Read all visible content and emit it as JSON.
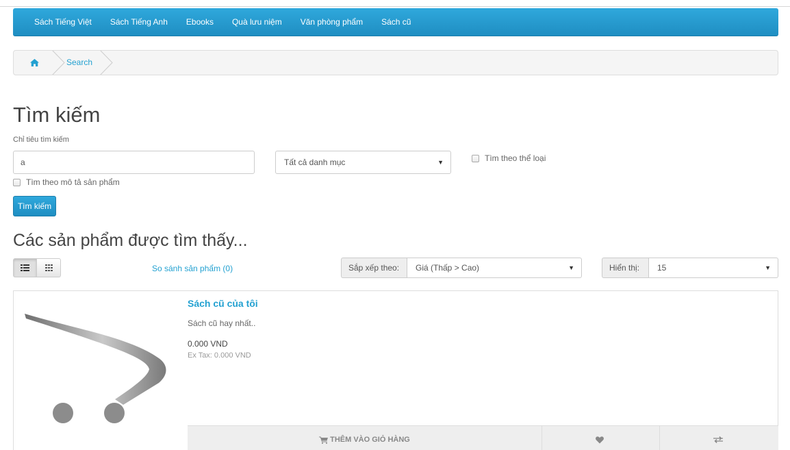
{
  "menu": {
    "items": [
      "Sách Tiếng Việt",
      "Sách Tiếng Anh",
      "Ebooks",
      "Quà lưu niệm",
      "Văn phòng phẩm",
      "Sách cũ"
    ]
  },
  "breadcrumb": {
    "home_icon": "home-icon",
    "current": "Search"
  },
  "search": {
    "title": "Tìm kiếm",
    "criteria_label": "Chỉ tiêu tìm kiếm",
    "query_value": "a",
    "category_selected": "Tất cả danh mục",
    "subcategory_label": "Tìm theo thể loại",
    "description_label": "Tìm theo mô tả sản phẩm",
    "submit_label": "Tìm kiếm"
  },
  "results": {
    "title": "Các sản phẩm được tìm thấy...",
    "compare_link": "So sánh sản phẩm (0)",
    "sort_label": "Sắp xếp theo:",
    "sort_selected": "Giá (Thấp > Cao)",
    "limit_label": "Hiển thị:",
    "limit_selected": "15"
  },
  "products": [
    {
      "name": "Sách cũ của tôi",
      "description": "Sách cũ hay nhất..",
      "price": "0.000 VND",
      "tax": "Ex Tax: 0.000 VND",
      "cart_label": "THÊM VÀO GIỎ HÀNG",
      "image_icon": "shopping-cart-placeholder-icon"
    }
  ],
  "colors": {
    "accent": "#1f9bd1",
    "link": "#23a1d1"
  }
}
